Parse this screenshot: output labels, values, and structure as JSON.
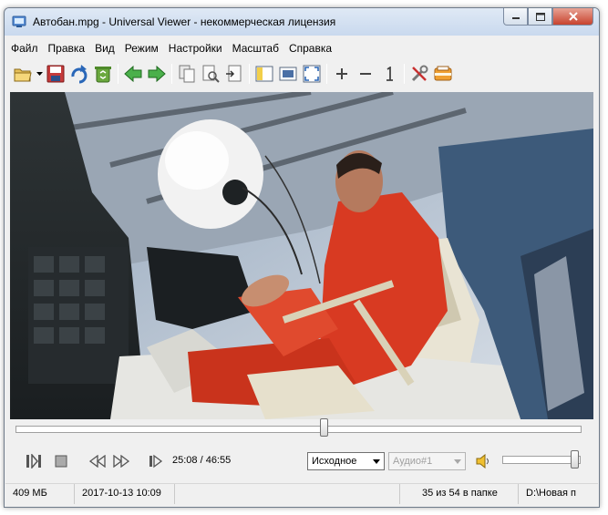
{
  "window": {
    "title": "Автобан.mpg - Universal Viewer - некоммерческая лицензия",
    "accent": "#c9d9ee"
  },
  "menu": [
    {
      "label": "Файл"
    },
    {
      "label": "Правка"
    },
    {
      "label": "Вид"
    },
    {
      "label": "Режим"
    },
    {
      "label": "Настройки"
    },
    {
      "label": "Масштаб"
    },
    {
      "label": "Справка"
    }
  ],
  "toolbar": {
    "icons": [
      "open-icon",
      "dropdown-arrow-icon",
      "save-icon",
      "reload-icon",
      "recycle-icon",
      "back-arrow-icon",
      "forward-arrow-icon",
      "copy-icon",
      "print-preview-icon",
      "export-icon",
      "panel-icon",
      "fit-window-icon",
      "fullscreen-icon",
      "zoom-in-icon",
      "zoom-out-icon",
      "original-size-icon",
      "tools-icon",
      "folder-icon"
    ]
  },
  "player": {
    "position_fraction": 0.545,
    "time": "25:08 / 46:55",
    "video_mode": "Исходное",
    "audio_track": "Аудио#1",
    "volume_fraction": 0.98,
    "icons": [
      "play-pause-icon",
      "stop-icon",
      "rewind-icon",
      "fast-forward-icon",
      "next-frame-icon",
      "speaker-icon"
    ]
  },
  "status": {
    "size": "409 МБ",
    "date": "2017-10-13 10:09",
    "index": "35 из 54 в папке",
    "path": "D:\\Новая п"
  }
}
